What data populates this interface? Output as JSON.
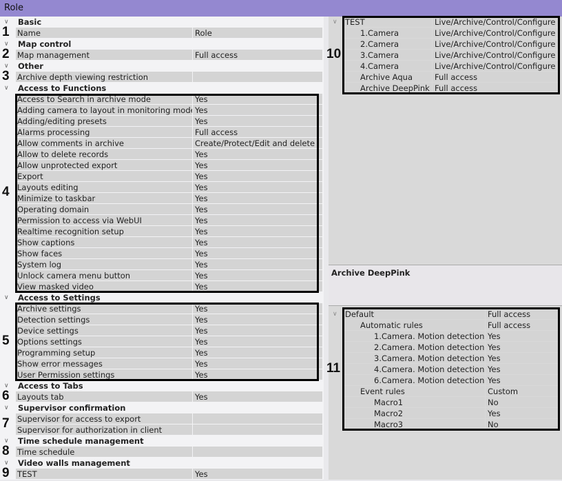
{
  "title": "Role",
  "left_rows": [
    {
      "type": "category",
      "label": "Basic"
    },
    {
      "type": "prop",
      "label": "Name",
      "value": "Role"
    },
    {
      "type": "category",
      "label": "Map control"
    },
    {
      "type": "prop",
      "label": "Map management",
      "value": "Full access"
    },
    {
      "type": "category",
      "label": "Other"
    },
    {
      "type": "prop",
      "label": "Archive depth viewing restriction",
      "value": ""
    },
    {
      "type": "category",
      "label": "Access to Functions"
    },
    {
      "type": "prop",
      "label": "Access to Search in archive mode",
      "value": "Yes"
    },
    {
      "type": "prop",
      "label": "Adding camera to layout in monitoring mode",
      "value": "Yes"
    },
    {
      "type": "prop",
      "label": "Adding/editing presets",
      "value": "Yes"
    },
    {
      "type": "prop",
      "label": "Alarms processing",
      "value": "Full access"
    },
    {
      "type": "prop",
      "label": "Allow comments in archive",
      "value": "Create/Protect/Edit and delete"
    },
    {
      "type": "prop",
      "label": "Allow to delete records",
      "value": "Yes"
    },
    {
      "type": "prop",
      "label": "Allow unprotected export",
      "value": "Yes"
    },
    {
      "type": "prop",
      "label": "Export",
      "value": "Yes"
    },
    {
      "type": "prop",
      "label": "Layouts editing",
      "value": "Yes"
    },
    {
      "type": "prop",
      "label": "Minimize to taskbar",
      "value": "Yes"
    },
    {
      "type": "prop",
      "label": "Operating domain",
      "value": "Yes"
    },
    {
      "type": "prop",
      "label": "Permission to access via WebUI",
      "value": "Yes"
    },
    {
      "type": "prop",
      "label": "Realtime recognition setup",
      "value": "Yes"
    },
    {
      "type": "prop",
      "label": "Show captions",
      "value": "Yes"
    },
    {
      "type": "prop",
      "label": "Show faces",
      "value": "Yes"
    },
    {
      "type": "prop",
      "label": "System log",
      "value": "Yes"
    },
    {
      "type": "prop",
      "label": "Unlock camera menu button",
      "value": "Yes"
    },
    {
      "type": "prop",
      "label": "View masked video",
      "value": "Yes"
    },
    {
      "type": "category",
      "label": "Access to Settings"
    },
    {
      "type": "prop",
      "label": "Archive settings",
      "value": "Yes"
    },
    {
      "type": "prop",
      "label": "Detection settings",
      "value": "Yes"
    },
    {
      "type": "prop",
      "label": "Device settings",
      "value": "Yes"
    },
    {
      "type": "prop",
      "label": "Options settings",
      "value": "Yes"
    },
    {
      "type": "prop",
      "label": "Programming setup",
      "value": "Yes"
    },
    {
      "type": "prop",
      "label": "Show error messages",
      "value": "Yes"
    },
    {
      "type": "prop",
      "label": "User Permission settings",
      "value": "Yes"
    },
    {
      "type": "category",
      "label": "Access to Tabs"
    },
    {
      "type": "prop",
      "label": "Layouts tab",
      "value": "Yes"
    },
    {
      "type": "category",
      "label": "Supervisor confirmation"
    },
    {
      "type": "prop",
      "label": "Supervisor for access to export",
      "value": ""
    },
    {
      "type": "prop",
      "label": "Supervisor for authorization in client",
      "value": ""
    },
    {
      "type": "category",
      "label": "Time schedule management"
    },
    {
      "type": "prop",
      "label": "Time schedule",
      "value": ""
    },
    {
      "type": "category",
      "label": "Video walls management"
    },
    {
      "type": "prop",
      "label": "TEST",
      "value": "Yes"
    }
  ],
  "markers": [
    "1",
    "2",
    "3",
    "4",
    "5",
    "6",
    "7",
    "8",
    "9",
    "10",
    "11"
  ],
  "devices_tree": [
    {
      "label": "TEST",
      "value": "Live/Archive/Control/Configure",
      "level": 0,
      "chev": "v"
    },
    {
      "label": "1.Camera",
      "value": "Live/Archive/Control/Configure",
      "level": 1,
      "chev": ">"
    },
    {
      "label": "2.Camera",
      "value": "Live/Archive/Control/Configure",
      "level": 1,
      "chev": ">"
    },
    {
      "label": "3.Camera",
      "value": "Live/Archive/Control/Configure",
      "level": 1,
      "chev": ">"
    },
    {
      "label": "4.Camera",
      "value": "Live/Archive/Control/Configure",
      "level": 1,
      "chev": ">"
    },
    {
      "label": "Archive Aqua",
      "value": "Full access",
      "level": 1,
      "chev": ">"
    },
    {
      "label": "Archive DeepPink",
      "value": "Full access",
      "level": 1,
      "chev": ">"
    }
  ],
  "description": {
    "title": "Archive DeepPink"
  },
  "rules_tree": [
    {
      "label": "Default",
      "value": "Full access",
      "level": 0,
      "chev": "v"
    },
    {
      "label": "Automatic rules",
      "value": "Full access",
      "level": 1,
      "chev": "v"
    },
    {
      "label": "1.Camera. Motion detection",
      "value": "Yes",
      "level": 2,
      "chev": ""
    },
    {
      "label": "2.Camera. Motion detection",
      "value": "Yes",
      "level": 2,
      "chev": ""
    },
    {
      "label": "3.Camera. Motion detection",
      "value": "Yes",
      "level": 2,
      "chev": ""
    },
    {
      "label": "4.Camera. Motion detection",
      "value": "Yes",
      "level": 2,
      "chev": ""
    },
    {
      "label": "6.Camera. Motion detection",
      "value": "Yes",
      "level": 2,
      "chev": ""
    },
    {
      "label": "Event rules",
      "value": "Custom",
      "level": 1,
      "chev": "v"
    },
    {
      "label": "Macro1",
      "value": "No",
      "level": 2,
      "chev": ""
    },
    {
      "label": "Macro2",
      "value": "Yes",
      "level": 2,
      "chev": ""
    },
    {
      "label": "Macro3",
      "value": "No",
      "level": 2,
      "chev": ""
    }
  ]
}
